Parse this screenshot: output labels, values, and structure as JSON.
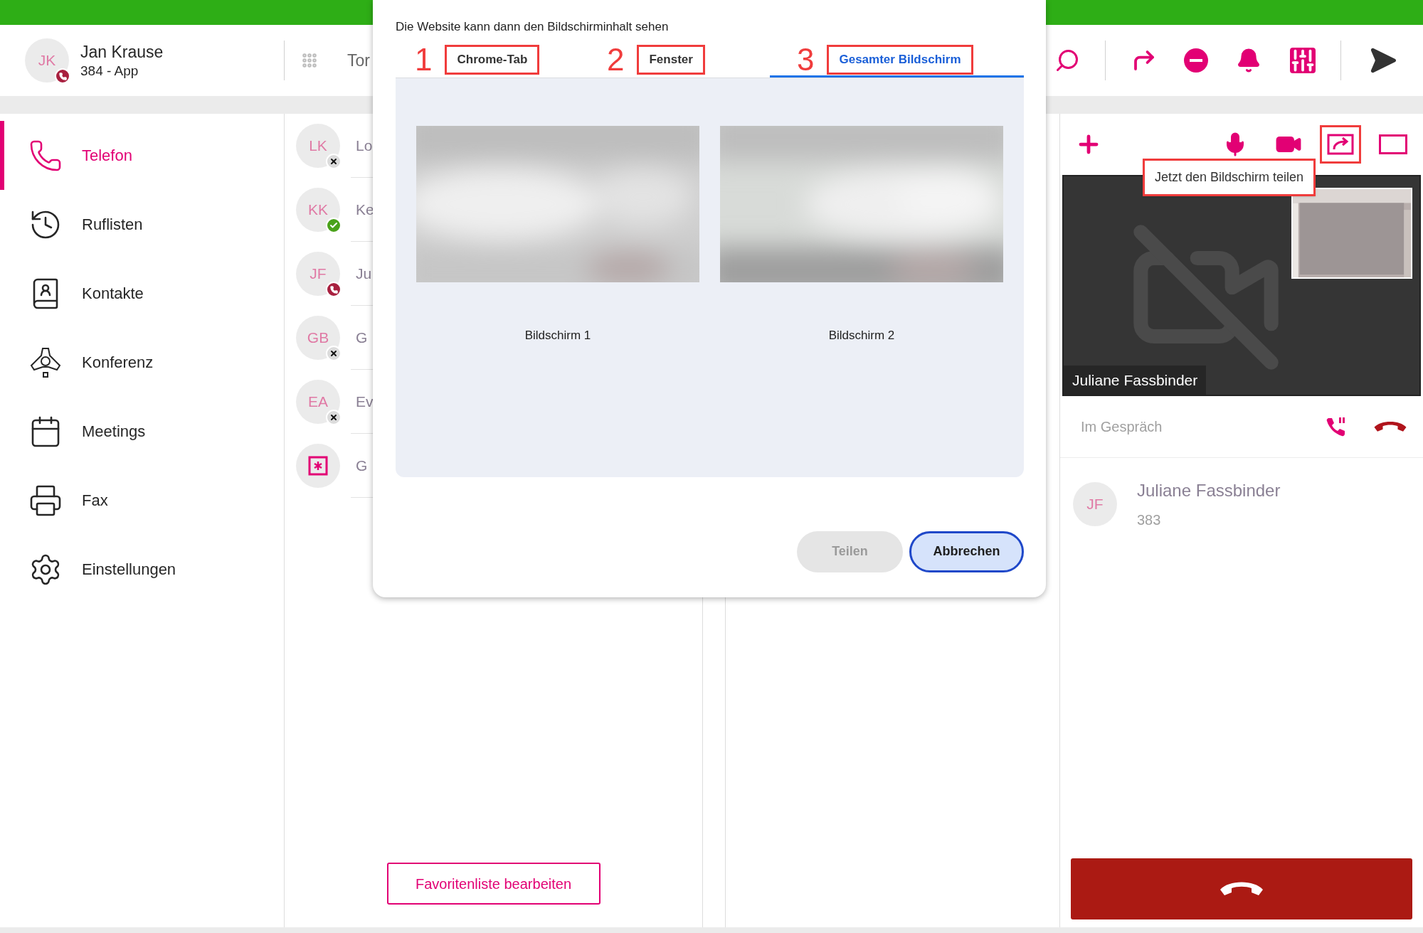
{
  "header": {
    "user": {
      "initials": "JK",
      "name": "Jan Krause",
      "line": "384 - App",
      "badge": {
        "kind": "busy"
      }
    },
    "search_text": "Tor"
  },
  "sidebar": {
    "items": [
      {
        "label": "Telefon",
        "selected": true
      },
      {
        "label": "Ruflisten",
        "selected": false
      },
      {
        "label": "Kontakte",
        "selected": false
      },
      {
        "label": "Konferenz",
        "selected": false
      },
      {
        "label": "Meetings",
        "selected": false
      },
      {
        "label": "Fax",
        "selected": false
      },
      {
        "label": "Einstellungen",
        "selected": false
      }
    ]
  },
  "favorites": {
    "items": [
      {
        "kind": "contact",
        "initials": "LK",
        "name": "Lo",
        "badge": {
          "kind": "offline"
        }
      },
      {
        "kind": "contact",
        "initials": "KK",
        "name": "Ke",
        "badge": {
          "kind": "available"
        }
      },
      {
        "kind": "contact",
        "initials": "JF",
        "name": "Ju",
        "badge": {
          "kind": "busy"
        }
      },
      {
        "kind": "contact",
        "initials": "GB",
        "name": "G",
        "badge": {
          "kind": "offline"
        }
      },
      {
        "kind": "contact",
        "initials": "EA",
        "name": "Ev",
        "badge": {
          "kind": "offline"
        }
      },
      {
        "kind": "group",
        "name": "G"
      }
    ],
    "edit_button": "Favoritenliste bearbeiten"
  },
  "call_panel": {
    "share_button": {
      "annotated": true
    },
    "tooltip": {
      "text": "Jetzt den Bildschirm teilen",
      "annotated": true
    },
    "video_caption": "Juliane Fassbinder",
    "status": "Im Gespräch",
    "contact": {
      "initials": "JF",
      "name": "Juliane Fassbinder",
      "number": "383"
    }
  },
  "share_dialog": {
    "subtitle": "Die Website kann dann den Bildschirminhalt sehen",
    "tabs": [
      {
        "number": "1",
        "label": "Chrome-Tab",
        "selected": false,
        "annotated": true
      },
      {
        "number": "2",
        "label": "Fenster",
        "selected": false,
        "annotated": true
      },
      {
        "number": "3",
        "label": "Gesamter Bildschirm",
        "selected": true,
        "annotated": true
      }
    ],
    "screens": [
      {
        "label": "Bildschirm 1"
      },
      {
        "label": "Bildschirm 2"
      }
    ],
    "buttons": [
      {
        "label": "Teilen",
        "kind": "secondary",
        "disabled": true
      },
      {
        "label": "Abbrechen",
        "kind": "primary",
        "disabled": false
      }
    ]
  }
}
